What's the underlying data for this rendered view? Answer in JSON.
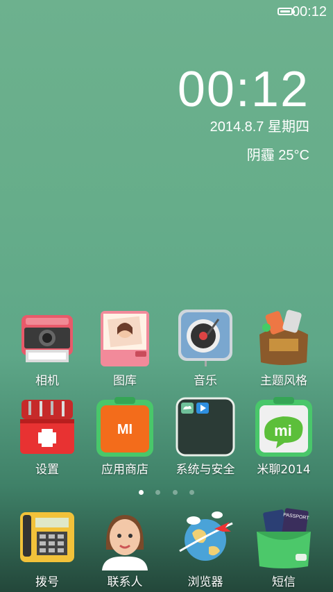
{
  "status": {
    "time": "00:12",
    "battery_icon": "battery-icon"
  },
  "clock": {
    "time": "00:12",
    "date": "2014.8.7 星期四",
    "weather": "阴霾 25°C"
  },
  "grid": {
    "row1": [
      {
        "label": "相机",
        "icon": "camera-icon"
      },
      {
        "label": "图库",
        "icon": "gallery-icon"
      },
      {
        "label": "音乐",
        "icon": "music-icon"
      },
      {
        "label": "主题风格",
        "icon": "theme-icon"
      }
    ],
    "row2": [
      {
        "label": "设置",
        "icon": "settings-icon"
      },
      {
        "label": "应用商店",
        "icon": "app-store-icon",
        "badge_text": "MI"
      },
      {
        "label": "系统与安全",
        "icon": "system-security-folder-icon"
      },
      {
        "label": "米聊2014",
        "icon": "miliao-icon",
        "badge_text": "mi"
      }
    ]
  },
  "page_indicator": {
    "count": 4,
    "active": 0
  },
  "dock": [
    {
      "label": "拨号",
      "icon": "phone-icon"
    },
    {
      "label": "联系人",
      "icon": "contacts-icon"
    },
    {
      "label": "浏览器",
      "icon": "browser-icon"
    },
    {
      "label": "短信",
      "icon": "messages-icon",
      "badge_text": "PASSPORT"
    }
  ]
}
